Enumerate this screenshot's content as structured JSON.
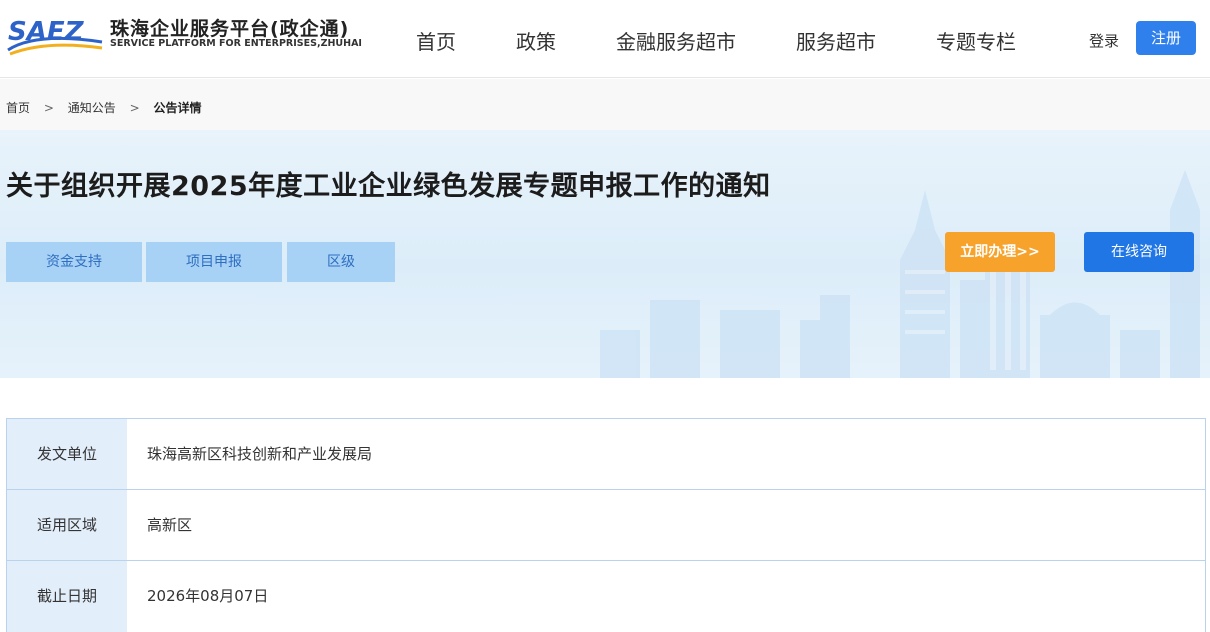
{
  "header": {
    "logo_mark": "SAEZ",
    "logo_cn": "珠海企业服务平台(政企通)",
    "logo_en": "SERVICE PLATFORM FOR ENTERPRISES,ZHUHAI",
    "nav": [
      "首页",
      "政策",
      "金融服务超市",
      "服务超市",
      "专题专栏"
    ],
    "login": "登录",
    "register": "注册",
    "colors": {
      "register_bg": "#2f80ed"
    }
  },
  "breadcrumb": {
    "items": [
      "首页",
      "通知公告",
      "公告详情"
    ],
    "separator": ">"
  },
  "banner": {
    "title": "关于组织开展2025年度工业企业绿色发展专题申报工作的通知",
    "tags": [
      "资金支持",
      "项目申报",
      "区级"
    ],
    "handle_button": "立即办理>>",
    "consult_button": "在线咨询",
    "colors": {
      "handle_bg": "#f7a22a",
      "consult_bg": "#2176e5",
      "tag_bg": "#a8d1f6"
    }
  },
  "info": {
    "rows": [
      {
        "label": "发文单位",
        "value": "珠海高新区科技创新和产业发展局"
      },
      {
        "label": "适用区域",
        "value": "高新区"
      },
      {
        "label": "截止日期",
        "value": "2026年08月07日"
      }
    ]
  }
}
